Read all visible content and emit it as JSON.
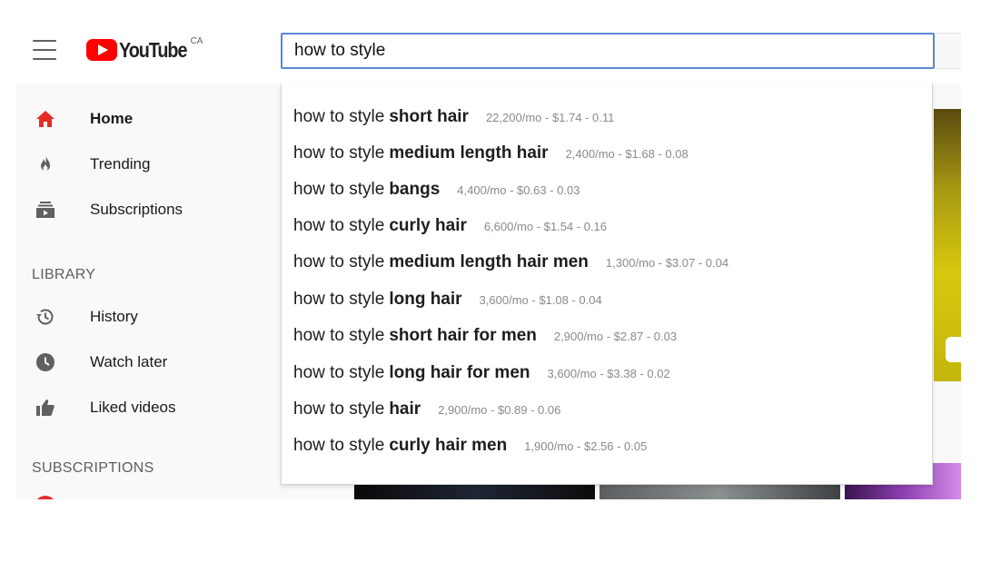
{
  "header": {
    "logo_text": "YouTube",
    "region": "CA",
    "search_value": "how to style"
  },
  "sidebar": {
    "nav": [
      {
        "label": "Home"
      },
      {
        "label": "Trending"
      },
      {
        "label": "Subscriptions"
      }
    ],
    "library_title": "LIBRARY",
    "library": [
      {
        "label": "History"
      },
      {
        "label": "Watch later"
      },
      {
        "label": "Liked videos"
      }
    ],
    "subscriptions_title": "SUBSCRIPTIONS"
  },
  "suggestions": [
    {
      "prefix": "how to style",
      "suffix": "short hair",
      "stats": "22,200/mo - $1.74 - 0.11"
    },
    {
      "prefix": "how to style",
      "suffix": "medium length hair",
      "stats": "2,400/mo - $1.68 - 0.08"
    },
    {
      "prefix": "how to style",
      "suffix": "bangs",
      "stats": "4,400/mo - $0.63 - 0.03"
    },
    {
      "prefix": "how to style",
      "suffix": "curly hair",
      "stats": "6,600/mo - $1.54 - 0.16"
    },
    {
      "prefix": "how to style",
      "suffix": "medium length hair men",
      "stats": "1,300/mo - $3.07 - 0.04"
    },
    {
      "prefix": "how to style",
      "suffix": "long hair",
      "stats": "3,600/mo - $1.08 - 0.04"
    },
    {
      "prefix": "how to style",
      "suffix": "short hair for men",
      "stats": "2,900/mo - $2.87 - 0.03"
    },
    {
      "prefix": "how to style",
      "suffix": "long hair for men",
      "stats": "3,600/mo - $3.38 - 0.02"
    },
    {
      "prefix": "how to style",
      "suffix": "hair",
      "stats": "2,900/mo - $0.89 - 0.06"
    },
    {
      "prefix": "how to style",
      "suffix": "curly hair men",
      "stats": "1,900/mo - $2.56 - 0.05"
    }
  ],
  "colors": {
    "brand": "#ff0000",
    "search_focus": "#5b87d6"
  }
}
